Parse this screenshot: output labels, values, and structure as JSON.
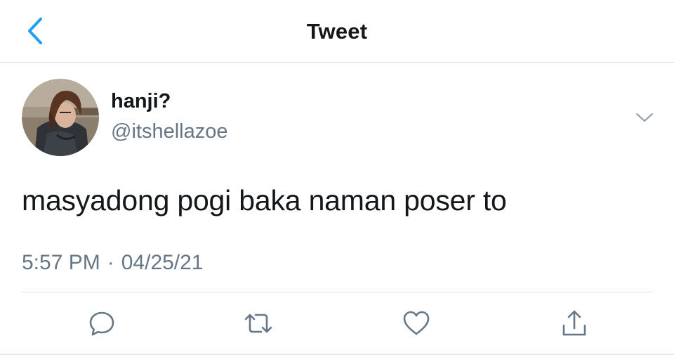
{
  "header": {
    "title": "Tweet",
    "back_icon": "chevron-left-icon"
  },
  "author": {
    "display_name": "hanji?",
    "handle": "@itshellazoe",
    "avatar": "profile-avatar"
  },
  "tweet": {
    "text": "masyadong pogi baka naman poser to",
    "time": "5:57 PM",
    "separator": "·",
    "date": "04/25/21"
  },
  "actions": [
    {
      "icon": "reply-icon"
    },
    {
      "icon": "retweet-icon"
    },
    {
      "icon": "like-icon"
    },
    {
      "icon": "share-icon"
    }
  ],
  "colors": {
    "accent": "#1da1f2",
    "text_primary": "#14171a",
    "text_secondary": "#657786",
    "divider": "#d4d8db"
  }
}
